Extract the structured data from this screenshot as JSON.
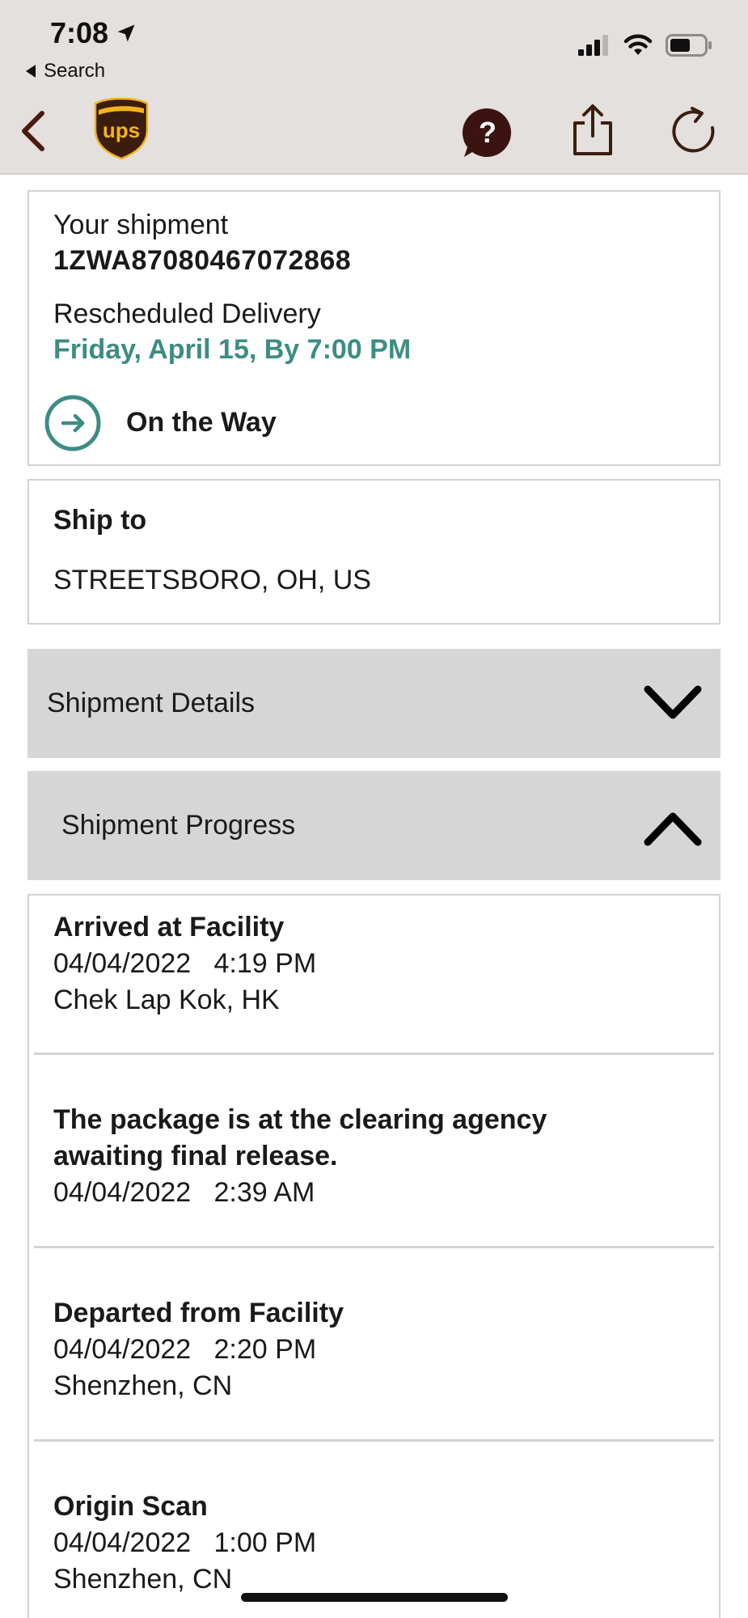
{
  "status_bar": {
    "time": "7:08",
    "back_app": "Search"
  },
  "icons": {
    "location": "location-arrow-icon",
    "signal": "cellular-signal-icon",
    "wifi": "wifi-icon",
    "battery": "battery-icon",
    "back": "chevron-left-icon",
    "logo": "ups-shield-logo",
    "help": "help-bubble-icon",
    "share": "share-icon",
    "refresh": "refresh-icon",
    "on_the_way": "arrow-circle-icon",
    "collapse": "chevron-up-icon",
    "expand": "chevron-down-icon"
  },
  "colors": {
    "header_bg": "#e3e0dd",
    "accent_teal": "#3d8c84",
    "ups_brown": "#3b1d0f",
    "ups_gold": "#f5b21b",
    "accordion_bg": "#d6d6d6"
  },
  "logo_text": "ups",
  "shipment": {
    "label": "Your shipment",
    "tracking_number": "1ZWA87080467072868",
    "delivery_label": "Rescheduled Delivery",
    "delivery_date": "Friday, April 15, By 7:00 PM",
    "status": "On the Way"
  },
  "ship_to": {
    "label": "Ship to",
    "address": "STREETSBORO, OH, US"
  },
  "sections": {
    "details_label": "Shipment Details",
    "progress_label": "Shipment Progress"
  },
  "events": [
    {
      "title": "Arrived at Facility",
      "date": "04/04/2022",
      "time": "4:19 PM",
      "location": "Chek Lap Kok, HK"
    },
    {
      "title_line1": "The package is at the clearing agency",
      "title_line2": "awaiting final release.",
      "date": "04/04/2022",
      "time": "2:39 AM"
    },
    {
      "title": "Departed from Facility",
      "date": "04/04/2022",
      "time": "2:20 PM",
      "location": "Shenzhen, CN"
    },
    {
      "title": "Origin Scan",
      "date": "04/04/2022",
      "time": "1:00 PM",
      "location": "Shenzhen, CN"
    }
  ]
}
